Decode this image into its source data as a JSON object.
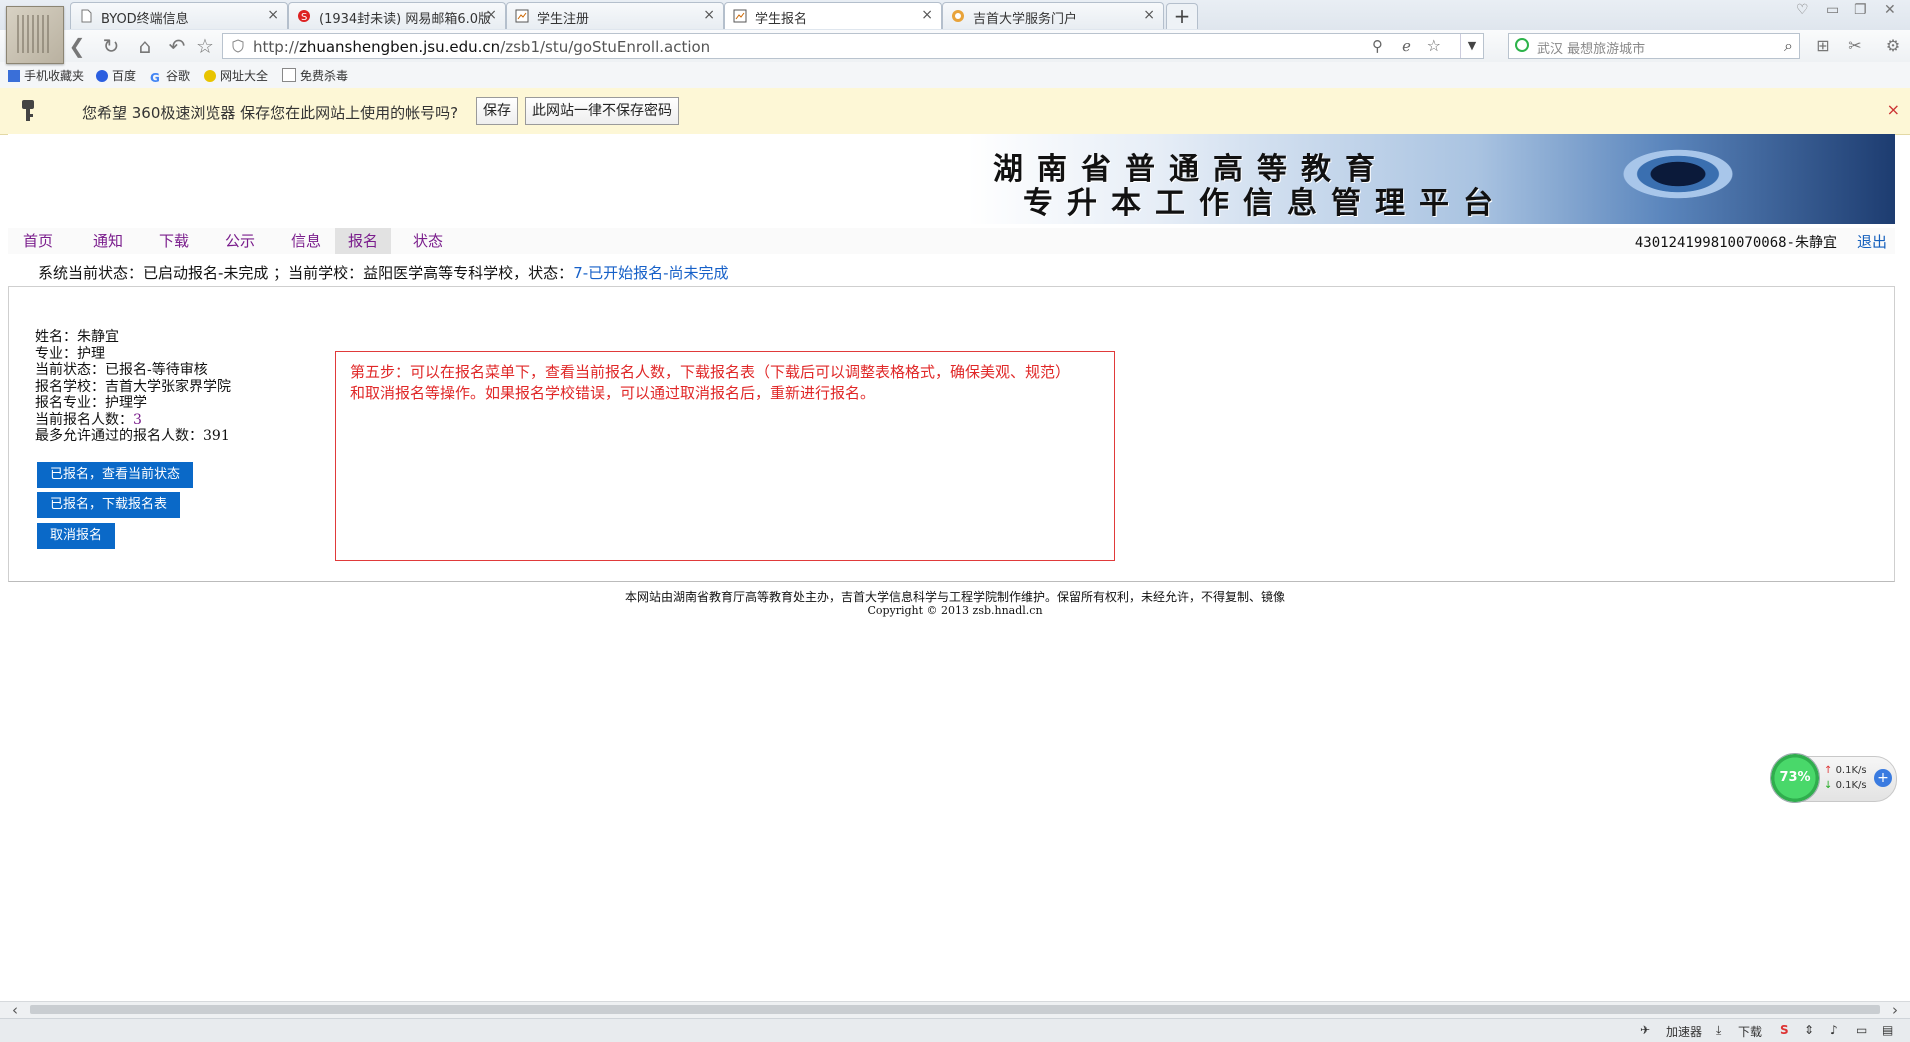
{
  "tabs": [
    {
      "label": "BYOD终端信息",
      "icon": "page-icon"
    },
    {
      "label": "(1934封未读) 网易邮箱6.0版",
      "icon": "netease-mail-icon"
    },
    {
      "label": "学生注册",
      "icon": "chart-page-icon"
    },
    {
      "label": "学生报名",
      "icon": "chart-page-icon"
    },
    {
      "label": "吉首大学服务门户",
      "icon": "portal-icon"
    }
  ],
  "active_tab": 3,
  "address": {
    "prefix": "http://",
    "host": "zhuanshengben.jsu.edu.cn",
    "path": "/zsb1/stu/goStuEnroll.action"
  },
  "search": {
    "placeholder": "武汉 最想旅游城市"
  },
  "bookmarks": [
    "手机收藏夹",
    "百度",
    "谷歌",
    "网址大全",
    "免费杀毒"
  ],
  "notify": {
    "text": "您希望 360极速浏览器 保存您在此网站上使用的帐号吗?",
    "save_label": "保存",
    "never_label": "此网站一律不保存密码",
    "close": "×"
  },
  "banner": {
    "line1": "湖南省普通高等教育",
    "line2": "专升本工作信息管理平台"
  },
  "nav": [
    "首页",
    "通知",
    "下载",
    "公示",
    "信息",
    "报名",
    "状态"
  ],
  "active_nav": 5,
  "user": {
    "id_name": "430124199810070068-朱静宜",
    "logout": "退出"
  },
  "status_line": {
    "prefix": "系统当前状态：已启动报名-未完成 ；当前学校：益阳医学高等专科学校，状态：",
    "state": "7-已开始报名-尚未完成"
  },
  "info": {
    "name": "姓名：朱静宜",
    "major": "专业：护理",
    "current_state": "当前状态：已报名-等待审核",
    "school": "报名学校：吉首大学张家界学院",
    "apply_major": "报名专业：护理学",
    "count_label": "当前报名人数：",
    "count_value": "3",
    "max_allowed": "最多允许通过的报名人数：391"
  },
  "buttons": {
    "view_status": "已报名，查看当前状态",
    "download_form": "已报名，下载报名表",
    "cancel": "取消报名"
  },
  "tip": {
    "line1": "第五步：可以在报名菜单下，查看当前报名人数，下载报名表（下载后可以调整表格格式，确保美观、规范）",
    "line2": "和取消报名等操作。如果报名学校错误，可以通过取消报名后，重新进行报名。"
  },
  "footer": {
    "line1": "本网站由湖南省教育厅高等教育处主办，吉首大学信息科学与工程学院制作维护。保留所有权利，未经允许，不得复制、镜像",
    "line2": "Copyright © 2013 zsb.hnadl.cn"
  },
  "speed_widget": {
    "percent": "73%",
    "up": "0.1K/s",
    "down": "0.1K/s"
  },
  "statusbar": {
    "accelerator": "加速器",
    "download": "下载"
  },
  "colors": {
    "nav_text": "#7a1d8c",
    "button_bg": "#0a69c8",
    "tip_red": "#e02828",
    "link_blue": "#1560bd"
  }
}
